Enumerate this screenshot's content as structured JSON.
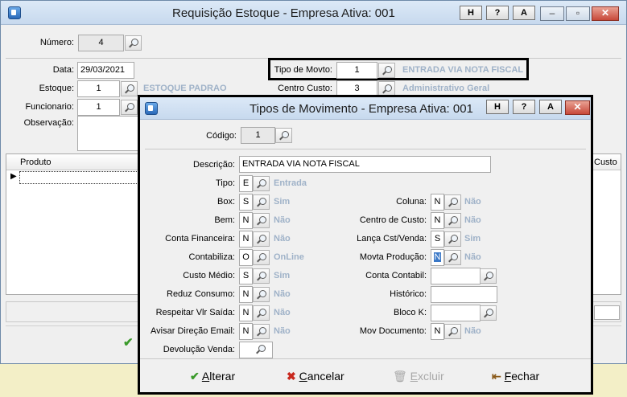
{
  "main": {
    "title": "Requisição Estoque - Empresa Ativa: 001",
    "title_buttons": [
      "H",
      "?",
      "A"
    ],
    "numero_label": "Número:",
    "numero": "4",
    "data_label": "Data:",
    "data": "29/03/2021",
    "estoque_label": "Estoque:",
    "estoque": "1",
    "estoque_desc": "ESTOQUE PADRAO",
    "funcionario_label": "Funcionario:",
    "funcionario": "1",
    "observacao_label": "Observação:",
    "tipo_movto_label": "Tipo de Movto:",
    "tipo_movto": "1",
    "tipo_movto_desc": "ENTRADA VIA NOTA FISCAL",
    "centro_custo_label": "Centro Custo:",
    "centro_custo": "3",
    "centro_custo_desc": "Administrativo Geral",
    "grid_col_produto": "Produto",
    "grid_col_custo": "Custo"
  },
  "dialog": {
    "title": "Tipos de Movimento - Empresa Ativa: 001",
    "title_buttons": [
      "H",
      "?",
      "A"
    ],
    "codigo_label": "Código:",
    "codigo": "1",
    "descricao_label": "Descrição:",
    "descricao": "ENTRADA VIA NOTA FISCAL",
    "left": [
      {
        "label": "Tipo:",
        "value": "E",
        "desc": "Entrada"
      },
      {
        "label": "Box:",
        "value": "S",
        "desc": "Sim"
      },
      {
        "label": "Bem:",
        "value": "N",
        "desc": "Não"
      },
      {
        "label": "Conta Financeira:",
        "value": "N",
        "desc": "Não"
      },
      {
        "label": "Contabiliza:",
        "value": "O",
        "desc": "OnLine"
      },
      {
        "label": "Custo Médio:",
        "value": "S",
        "desc": "Sim"
      },
      {
        "label": "Reduz Consumo:",
        "value": "N",
        "desc": "Não"
      },
      {
        "label": "Respeitar Vlr Saída:",
        "value": "N",
        "desc": "Não"
      },
      {
        "label": "Avisar Direção Email:",
        "value": "N",
        "desc": "Não"
      },
      {
        "label": "Devolução Venda:",
        "value": "",
        "desc": ""
      }
    ],
    "right": [
      {
        "label": "Coluna:",
        "value": "N",
        "desc": "Não"
      },
      {
        "label": "Centro de Custo:",
        "value": "N",
        "desc": "Não"
      },
      {
        "label": "Lança Cst/Venda:",
        "value": "S",
        "desc": "Sim"
      },
      {
        "label": "Movta Produção:",
        "value": "N",
        "desc": "Não"
      },
      {
        "label": "Conta Contabil:",
        "value": "",
        "desc": ""
      },
      {
        "label": "Histórico:",
        "value": "",
        "desc": ""
      },
      {
        "label": "Bloco K:",
        "value": "",
        "desc": ""
      },
      {
        "label": "Mov Documento:",
        "value": "N",
        "desc": "Não"
      }
    ],
    "buttons": {
      "alterar_u": "A",
      "alterar_rest": "lterar",
      "cancelar_u": "C",
      "cancelar_rest": "ancelar",
      "excluir_u": "E",
      "excluir_rest": "xcluir",
      "fechar_u": "F",
      "fechar_rest": "echar"
    }
  }
}
